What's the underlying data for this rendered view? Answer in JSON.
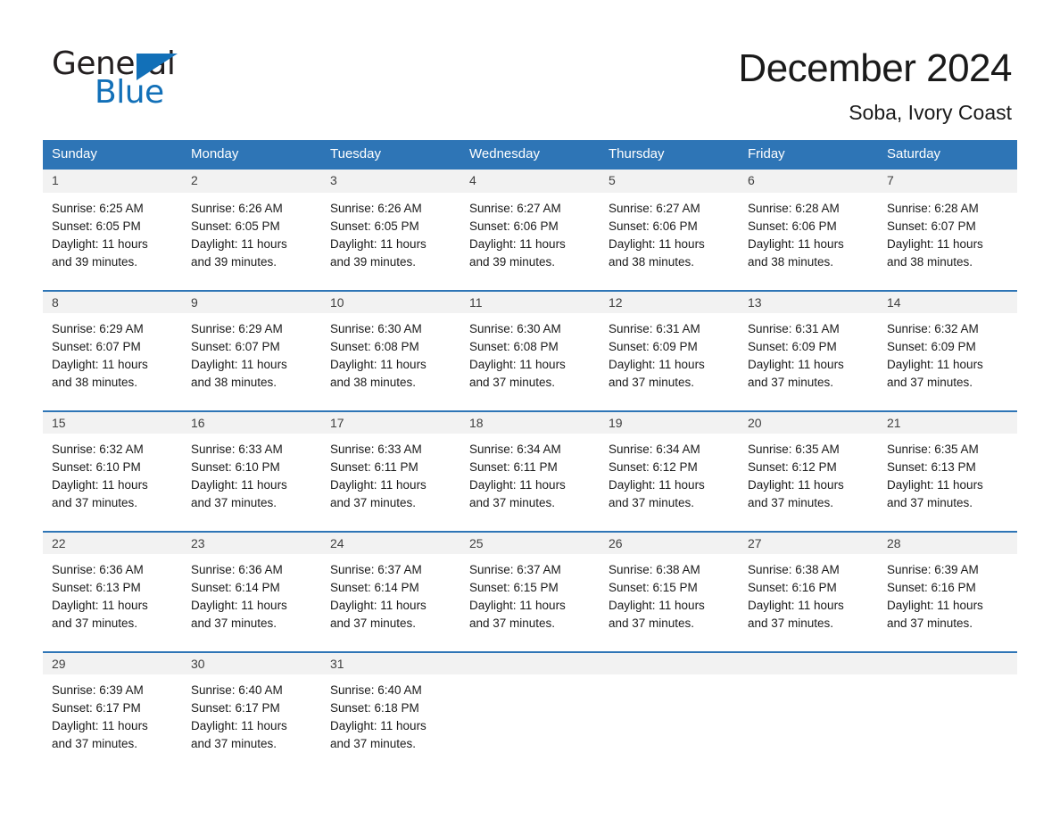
{
  "logo": {
    "text_primary": "General",
    "text_secondary": "Blue",
    "triangle_icon": "triangle-icon",
    "color_primary": "#231f20",
    "color_secondary": "#1270b8"
  },
  "header": {
    "title": "December 2024",
    "subtitle": "Soba, Ivory Coast"
  },
  "theme": {
    "header_blue": "#2e75b6",
    "daynum_band": "#f2f2f2",
    "text": "#1a1a1a"
  },
  "calendar": {
    "weekday_headers": [
      "Sunday",
      "Monday",
      "Tuesday",
      "Wednesday",
      "Thursday",
      "Friday",
      "Saturday"
    ],
    "weeks": [
      [
        {
          "day": "1",
          "sunrise": "Sunrise: 6:25 AM",
          "sunset": "Sunset: 6:05 PM",
          "daylight_line1": "Daylight: 11 hours",
          "daylight_line2": "and 39 minutes."
        },
        {
          "day": "2",
          "sunrise": "Sunrise: 6:26 AM",
          "sunset": "Sunset: 6:05 PM",
          "daylight_line1": "Daylight: 11 hours",
          "daylight_line2": "and 39 minutes."
        },
        {
          "day": "3",
          "sunrise": "Sunrise: 6:26 AM",
          "sunset": "Sunset: 6:05 PM",
          "daylight_line1": "Daylight: 11 hours",
          "daylight_line2": "and 39 minutes."
        },
        {
          "day": "4",
          "sunrise": "Sunrise: 6:27 AM",
          "sunset": "Sunset: 6:06 PM",
          "daylight_line1": "Daylight: 11 hours",
          "daylight_line2": "and 39 minutes."
        },
        {
          "day": "5",
          "sunrise": "Sunrise: 6:27 AM",
          "sunset": "Sunset: 6:06 PM",
          "daylight_line1": "Daylight: 11 hours",
          "daylight_line2": "and 38 minutes."
        },
        {
          "day": "6",
          "sunrise": "Sunrise: 6:28 AM",
          "sunset": "Sunset: 6:06 PM",
          "daylight_line1": "Daylight: 11 hours",
          "daylight_line2": "and 38 minutes."
        },
        {
          "day": "7",
          "sunrise": "Sunrise: 6:28 AM",
          "sunset": "Sunset: 6:07 PM",
          "daylight_line1": "Daylight: 11 hours",
          "daylight_line2": "and 38 minutes."
        }
      ],
      [
        {
          "day": "8",
          "sunrise": "Sunrise: 6:29 AM",
          "sunset": "Sunset: 6:07 PM",
          "daylight_line1": "Daylight: 11 hours",
          "daylight_line2": "and 38 minutes."
        },
        {
          "day": "9",
          "sunrise": "Sunrise: 6:29 AM",
          "sunset": "Sunset: 6:07 PM",
          "daylight_line1": "Daylight: 11 hours",
          "daylight_line2": "and 38 minutes."
        },
        {
          "day": "10",
          "sunrise": "Sunrise: 6:30 AM",
          "sunset": "Sunset: 6:08 PM",
          "daylight_line1": "Daylight: 11 hours",
          "daylight_line2": "and 38 minutes."
        },
        {
          "day": "11",
          "sunrise": "Sunrise: 6:30 AM",
          "sunset": "Sunset: 6:08 PM",
          "daylight_line1": "Daylight: 11 hours",
          "daylight_line2": "and 37 minutes."
        },
        {
          "day": "12",
          "sunrise": "Sunrise: 6:31 AM",
          "sunset": "Sunset: 6:09 PM",
          "daylight_line1": "Daylight: 11 hours",
          "daylight_line2": "and 37 minutes."
        },
        {
          "day": "13",
          "sunrise": "Sunrise: 6:31 AM",
          "sunset": "Sunset: 6:09 PM",
          "daylight_line1": "Daylight: 11 hours",
          "daylight_line2": "and 37 minutes."
        },
        {
          "day": "14",
          "sunrise": "Sunrise: 6:32 AM",
          "sunset": "Sunset: 6:09 PM",
          "daylight_line1": "Daylight: 11 hours",
          "daylight_line2": "and 37 minutes."
        }
      ],
      [
        {
          "day": "15",
          "sunrise": "Sunrise: 6:32 AM",
          "sunset": "Sunset: 6:10 PM",
          "daylight_line1": "Daylight: 11 hours",
          "daylight_line2": "and 37 minutes."
        },
        {
          "day": "16",
          "sunrise": "Sunrise: 6:33 AM",
          "sunset": "Sunset: 6:10 PM",
          "daylight_line1": "Daylight: 11 hours",
          "daylight_line2": "and 37 minutes."
        },
        {
          "day": "17",
          "sunrise": "Sunrise: 6:33 AM",
          "sunset": "Sunset: 6:11 PM",
          "daylight_line1": "Daylight: 11 hours",
          "daylight_line2": "and 37 minutes."
        },
        {
          "day": "18",
          "sunrise": "Sunrise: 6:34 AM",
          "sunset": "Sunset: 6:11 PM",
          "daylight_line1": "Daylight: 11 hours",
          "daylight_line2": "and 37 minutes."
        },
        {
          "day": "19",
          "sunrise": "Sunrise: 6:34 AM",
          "sunset": "Sunset: 6:12 PM",
          "daylight_line1": "Daylight: 11 hours",
          "daylight_line2": "and 37 minutes."
        },
        {
          "day": "20",
          "sunrise": "Sunrise: 6:35 AM",
          "sunset": "Sunset: 6:12 PM",
          "daylight_line1": "Daylight: 11 hours",
          "daylight_line2": "and 37 minutes."
        },
        {
          "day": "21",
          "sunrise": "Sunrise: 6:35 AM",
          "sunset": "Sunset: 6:13 PM",
          "daylight_line1": "Daylight: 11 hours",
          "daylight_line2": "and 37 minutes."
        }
      ],
      [
        {
          "day": "22",
          "sunrise": "Sunrise: 6:36 AM",
          "sunset": "Sunset: 6:13 PM",
          "daylight_line1": "Daylight: 11 hours",
          "daylight_line2": "and 37 minutes."
        },
        {
          "day": "23",
          "sunrise": "Sunrise: 6:36 AM",
          "sunset": "Sunset: 6:14 PM",
          "daylight_line1": "Daylight: 11 hours",
          "daylight_line2": "and 37 minutes."
        },
        {
          "day": "24",
          "sunrise": "Sunrise: 6:37 AM",
          "sunset": "Sunset: 6:14 PM",
          "daylight_line1": "Daylight: 11 hours",
          "daylight_line2": "and 37 minutes."
        },
        {
          "day": "25",
          "sunrise": "Sunrise: 6:37 AM",
          "sunset": "Sunset: 6:15 PM",
          "daylight_line1": "Daylight: 11 hours",
          "daylight_line2": "and 37 minutes."
        },
        {
          "day": "26",
          "sunrise": "Sunrise: 6:38 AM",
          "sunset": "Sunset: 6:15 PM",
          "daylight_line1": "Daylight: 11 hours",
          "daylight_line2": "and 37 minutes."
        },
        {
          "day": "27",
          "sunrise": "Sunrise: 6:38 AM",
          "sunset": "Sunset: 6:16 PM",
          "daylight_line1": "Daylight: 11 hours",
          "daylight_line2": "and 37 minutes."
        },
        {
          "day": "28",
          "sunrise": "Sunrise: 6:39 AM",
          "sunset": "Sunset: 6:16 PM",
          "daylight_line1": "Daylight: 11 hours",
          "daylight_line2": "and 37 minutes."
        }
      ],
      [
        {
          "day": "29",
          "sunrise": "Sunrise: 6:39 AM",
          "sunset": "Sunset: 6:17 PM",
          "daylight_line1": "Daylight: 11 hours",
          "daylight_line2": "and 37 minutes."
        },
        {
          "day": "30",
          "sunrise": "Sunrise: 6:40 AM",
          "sunset": "Sunset: 6:17 PM",
          "daylight_line1": "Daylight: 11 hours",
          "daylight_line2": "and 37 minutes."
        },
        {
          "day": "31",
          "sunrise": "Sunrise: 6:40 AM",
          "sunset": "Sunset: 6:18 PM",
          "daylight_line1": "Daylight: 11 hours",
          "daylight_line2": "and 37 minutes."
        },
        {
          "day": "",
          "sunrise": "",
          "sunset": "",
          "daylight_line1": "",
          "daylight_line2": ""
        },
        {
          "day": "",
          "sunrise": "",
          "sunset": "",
          "daylight_line1": "",
          "daylight_line2": ""
        },
        {
          "day": "",
          "sunrise": "",
          "sunset": "",
          "daylight_line1": "",
          "daylight_line2": ""
        },
        {
          "day": "",
          "sunrise": "",
          "sunset": "",
          "daylight_line1": "",
          "daylight_line2": ""
        }
      ]
    ]
  }
}
